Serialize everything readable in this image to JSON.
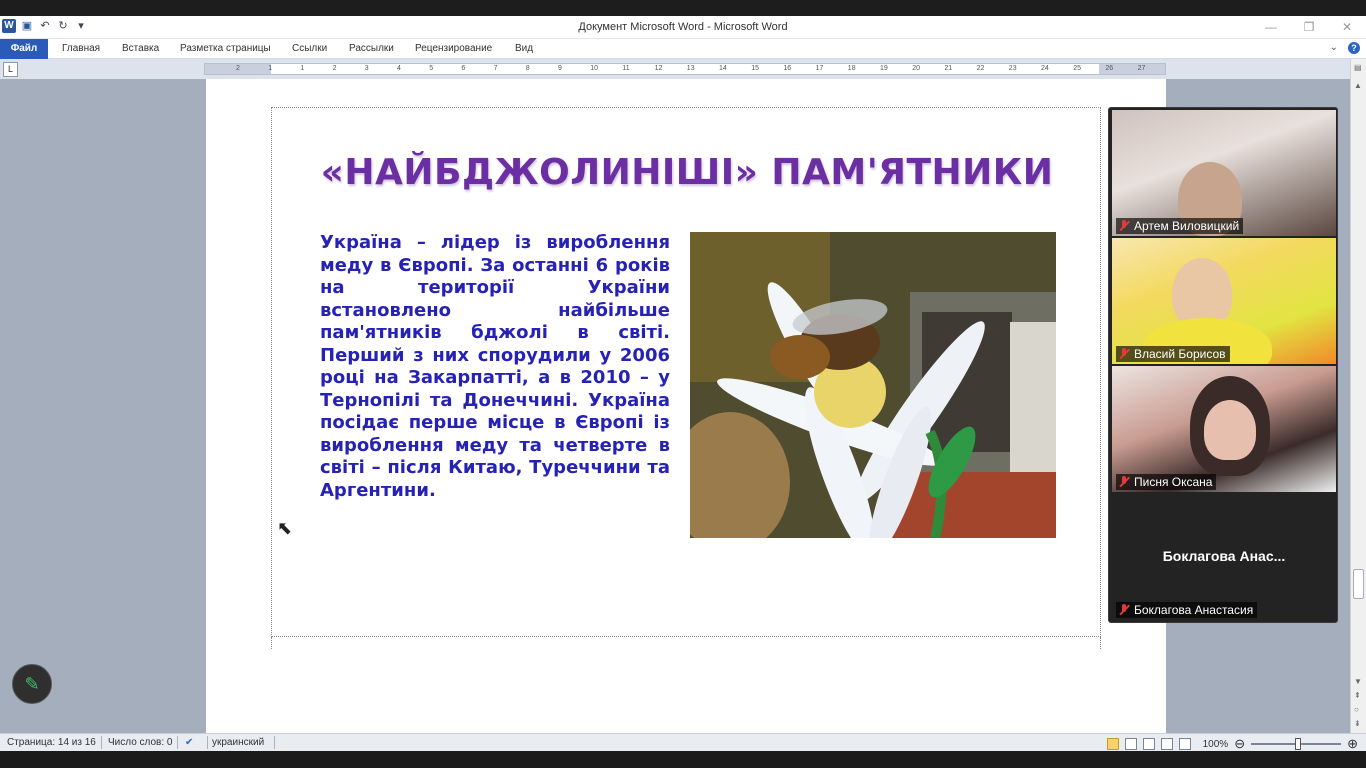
{
  "window": {
    "title": "Документ Microsoft Word - Microsoft Word",
    "qat": [
      "W",
      "💾",
      "↶",
      "↻",
      "▾"
    ],
    "controls": [
      "—",
      "❐",
      "✕"
    ]
  },
  "ribbon": {
    "file_tab": "Файл",
    "tabs": [
      "Главная",
      "Вставка",
      "Разметка страницы",
      "Ссылки",
      "Рассылки",
      "Рецензирование",
      "Вид"
    ],
    "help": "?"
  },
  "ruler": {
    "tab_selector": "L",
    "marks": [
      "2",
      "1",
      "1",
      "2",
      "3",
      "4",
      "5",
      "6",
      "7",
      "8",
      "9",
      "10",
      "11",
      "12",
      "13",
      "14",
      "15",
      "16",
      "17",
      "18",
      "19",
      "20",
      "21",
      "22",
      "23",
      "24",
      "25",
      "26",
      "27"
    ]
  },
  "document": {
    "slide_title": "«НАЙБДЖОЛИНІШІ» ПАМ'ЯТНИКИ",
    "slide_body": "Україна – лідер із вироблення меду в Європі. За останні 6 років на території України встановлено найбільше пам'ятників бджолі в світі. Перший з них спорудили у 2006 році на Закарпатті, а в 2010 – у Тернопілі та Донеччині. Україна посідає перше місце в Європі із вироблення меду та четверте в світі – після Китаю, Туреччини та Аргентини."
  },
  "statusbar": {
    "page": "Страница: 14 из 16",
    "words": "Число слов: 0",
    "language": "украинский",
    "zoom": "100%",
    "zoom_level": 1.0
  },
  "video_panel": {
    "participants": [
      {
        "name": "Артем Виловицкий",
        "muted": true
      },
      {
        "name": "Власий Борисов",
        "muted": true
      },
      {
        "name": "Писня Оксана",
        "muted": true
      },
      {
        "name": "Боклагова Анастасия",
        "muted": true,
        "display_title": "Боклагова Анас..."
      }
    ]
  },
  "colors": {
    "accent": "#2a5bb8",
    "title": "#6b2fa3",
    "body_text": "#2622b5",
    "muted_mic": "#e23b3b"
  }
}
